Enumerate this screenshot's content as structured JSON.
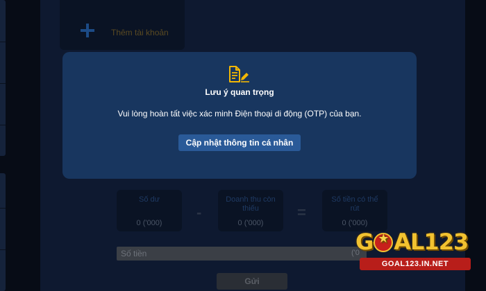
{
  "background": {
    "add_account_label": "Thêm tài khoản",
    "stats": [
      {
        "label": "Số dư",
        "value": "0 ('000)"
      },
      {
        "label": "Doanh thu còn thiếu",
        "value": "0 ('000)"
      },
      {
        "label": "Số tiền có thể rút",
        "value": "0 ('000)"
      }
    ],
    "operators": [
      "-",
      "="
    ],
    "amount_placeholder": "Số tiền",
    "amount_suffix": "('0",
    "submit_label": "Gửi"
  },
  "modal": {
    "icon": "document-edit-icon",
    "title": "Lưu ý quan trọng",
    "message": "Vui lòng hoàn tất việc xác minh Điện thoại di động (OTP) của bạn.",
    "button_label": "Cập nhật thông tin cá nhân"
  },
  "watermark": {
    "brand_pre": "G",
    "brand_post": "AL123",
    "domain": "GOAL123.IN.NET"
  },
  "colors": {
    "modal_bg": "#18365f",
    "modal_button": "#2a5a98",
    "icon_accent": "#f2b705"
  }
}
